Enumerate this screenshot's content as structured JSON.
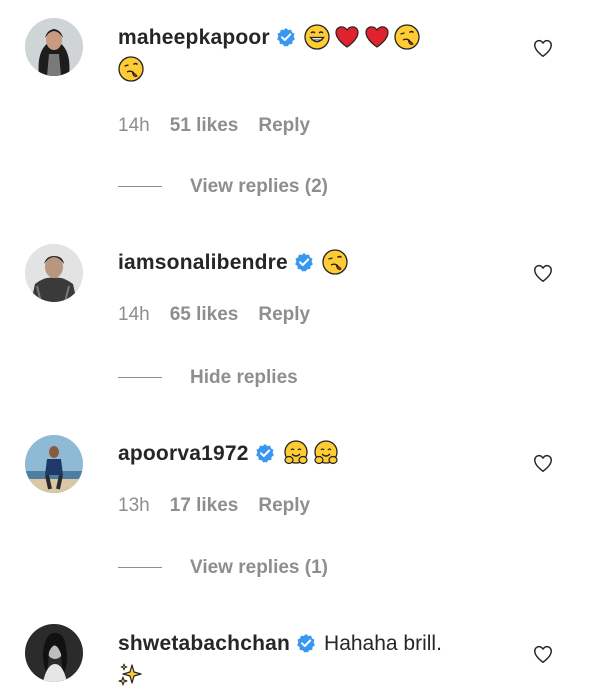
{
  "comments": [
    {
      "username": "maheepkapoor",
      "emojis": [
        "grin",
        "heart",
        "heart",
        "kiss"
      ],
      "emojis_line2": [
        "kiss"
      ],
      "text": "",
      "time": "14h",
      "likes": "51 likes",
      "reply": "Reply",
      "replies_label": "View replies (2)",
      "avatar": "woman-dark-hair"
    },
    {
      "username": "iamsonalibendre",
      "emojis": [
        "kiss"
      ],
      "emojis_line2": [],
      "text": "",
      "time": "14h",
      "likes": "65 likes",
      "reply": "Reply",
      "replies_label": "Hide replies",
      "avatar": "woman-short-hair"
    },
    {
      "username": "apoorva1972",
      "emojis": [
        "hug",
        "hug"
      ],
      "emojis_line2": [],
      "text": "",
      "time": "13h",
      "likes": "17 likes",
      "reply": "Reply",
      "replies_label": "View replies (1)",
      "avatar": "man-outdoors"
    },
    {
      "username": "shwetabachchan",
      "emojis": [],
      "emojis_line2": [
        "sparkles"
      ],
      "text": "Hahaha brill.",
      "avatar": "woman-bw"
    }
  ],
  "colors": {
    "text": "#262626",
    "muted": "#8e8e8e",
    "verified": "#3897f0",
    "heart_emoji": "#e0212e",
    "emoji_yellow": "#ffcc33"
  },
  "icons": {
    "verified": "verified-badge-icon",
    "like": "heart-outline-icon"
  }
}
